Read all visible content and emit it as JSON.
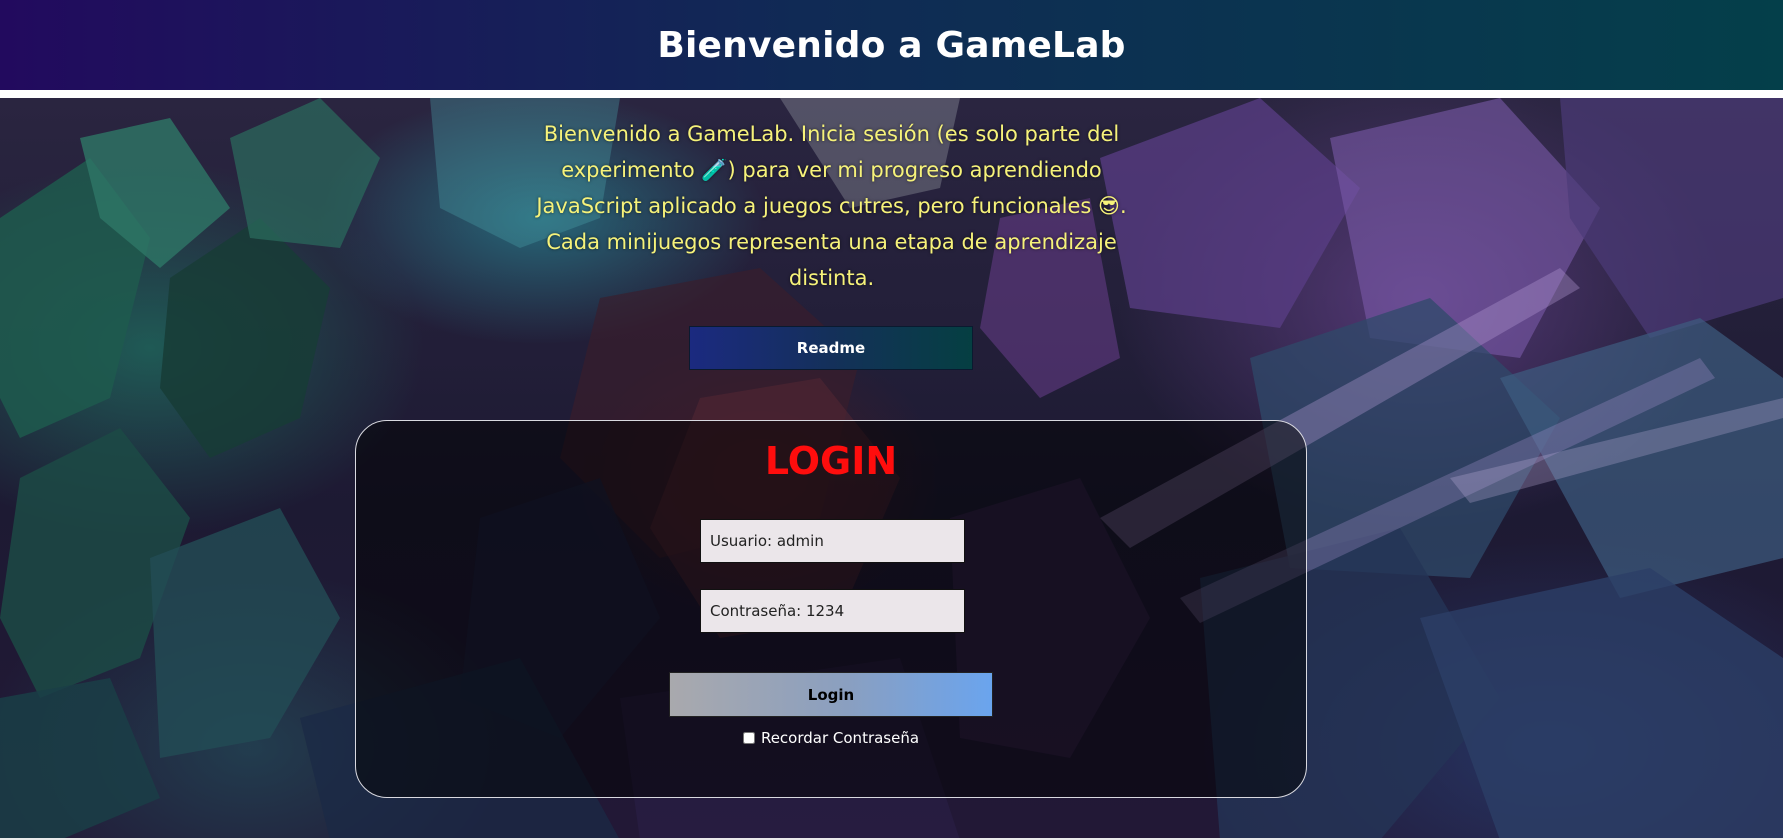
{
  "header": {
    "title": "Bienvenido a GameLab"
  },
  "intro": {
    "text": "Bienvenido a GameLab. Inicia sesión (es solo parte del experimento 🧪) para ver mi progreso aprendiendo JavaScript aplicado a juegos cutres, pero funcionales 😎. Cada minijuegos representa una etapa de aprendizaje distinta."
  },
  "readme": {
    "label": "Readme"
  },
  "login": {
    "title": "LOGIN",
    "username_placeholder": "Usuario: admin",
    "password_placeholder": "Contraseña: 1234",
    "submit_label": "Login",
    "remember_label": "Recordar Contraseña"
  },
  "colors": {
    "header_gradient": [
      "#220a5e",
      "#043f4a"
    ],
    "intro_text": "#f6f27a",
    "login_title": "#ff0d0d",
    "login_button_gradient": [
      "#a9a9ad",
      "#6aa4ee"
    ]
  }
}
